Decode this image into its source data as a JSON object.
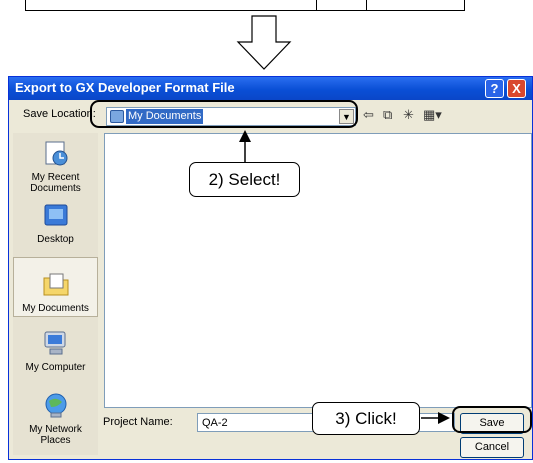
{
  "dialog": {
    "title": "Export to GX Developer Format File",
    "help_label": "?",
    "close_label": "X",
    "save_location_label": "Save Location:",
    "save_location_value": "My Documents",
    "places": [
      {
        "label": "My Recent Documents",
        "icon": "recent-documents-icon"
      },
      {
        "label": "Desktop",
        "icon": "desktop-icon"
      },
      {
        "label": "My Documents",
        "icon": "my-documents-icon"
      },
      {
        "label": "My Computer",
        "icon": "my-computer-icon"
      },
      {
        "label": "My Network Places",
        "icon": "network-places-icon"
      }
    ],
    "toolbar": {
      "back": "⇦",
      "up": "⧉",
      "new_folder": "✳",
      "view": "▦▾"
    },
    "project_name_label": "Project Name:",
    "project_name_value": "QA-2",
    "save_label": "Save",
    "cancel_label": "Cancel"
  },
  "annotations": {
    "select": "2) Select!",
    "click": "3) Click!"
  },
  "colors": {
    "titlebar": "#0a4fd6",
    "dialog_bg": "#ece9d8",
    "selection": "#316ac5",
    "close_button": "#d9482e"
  }
}
